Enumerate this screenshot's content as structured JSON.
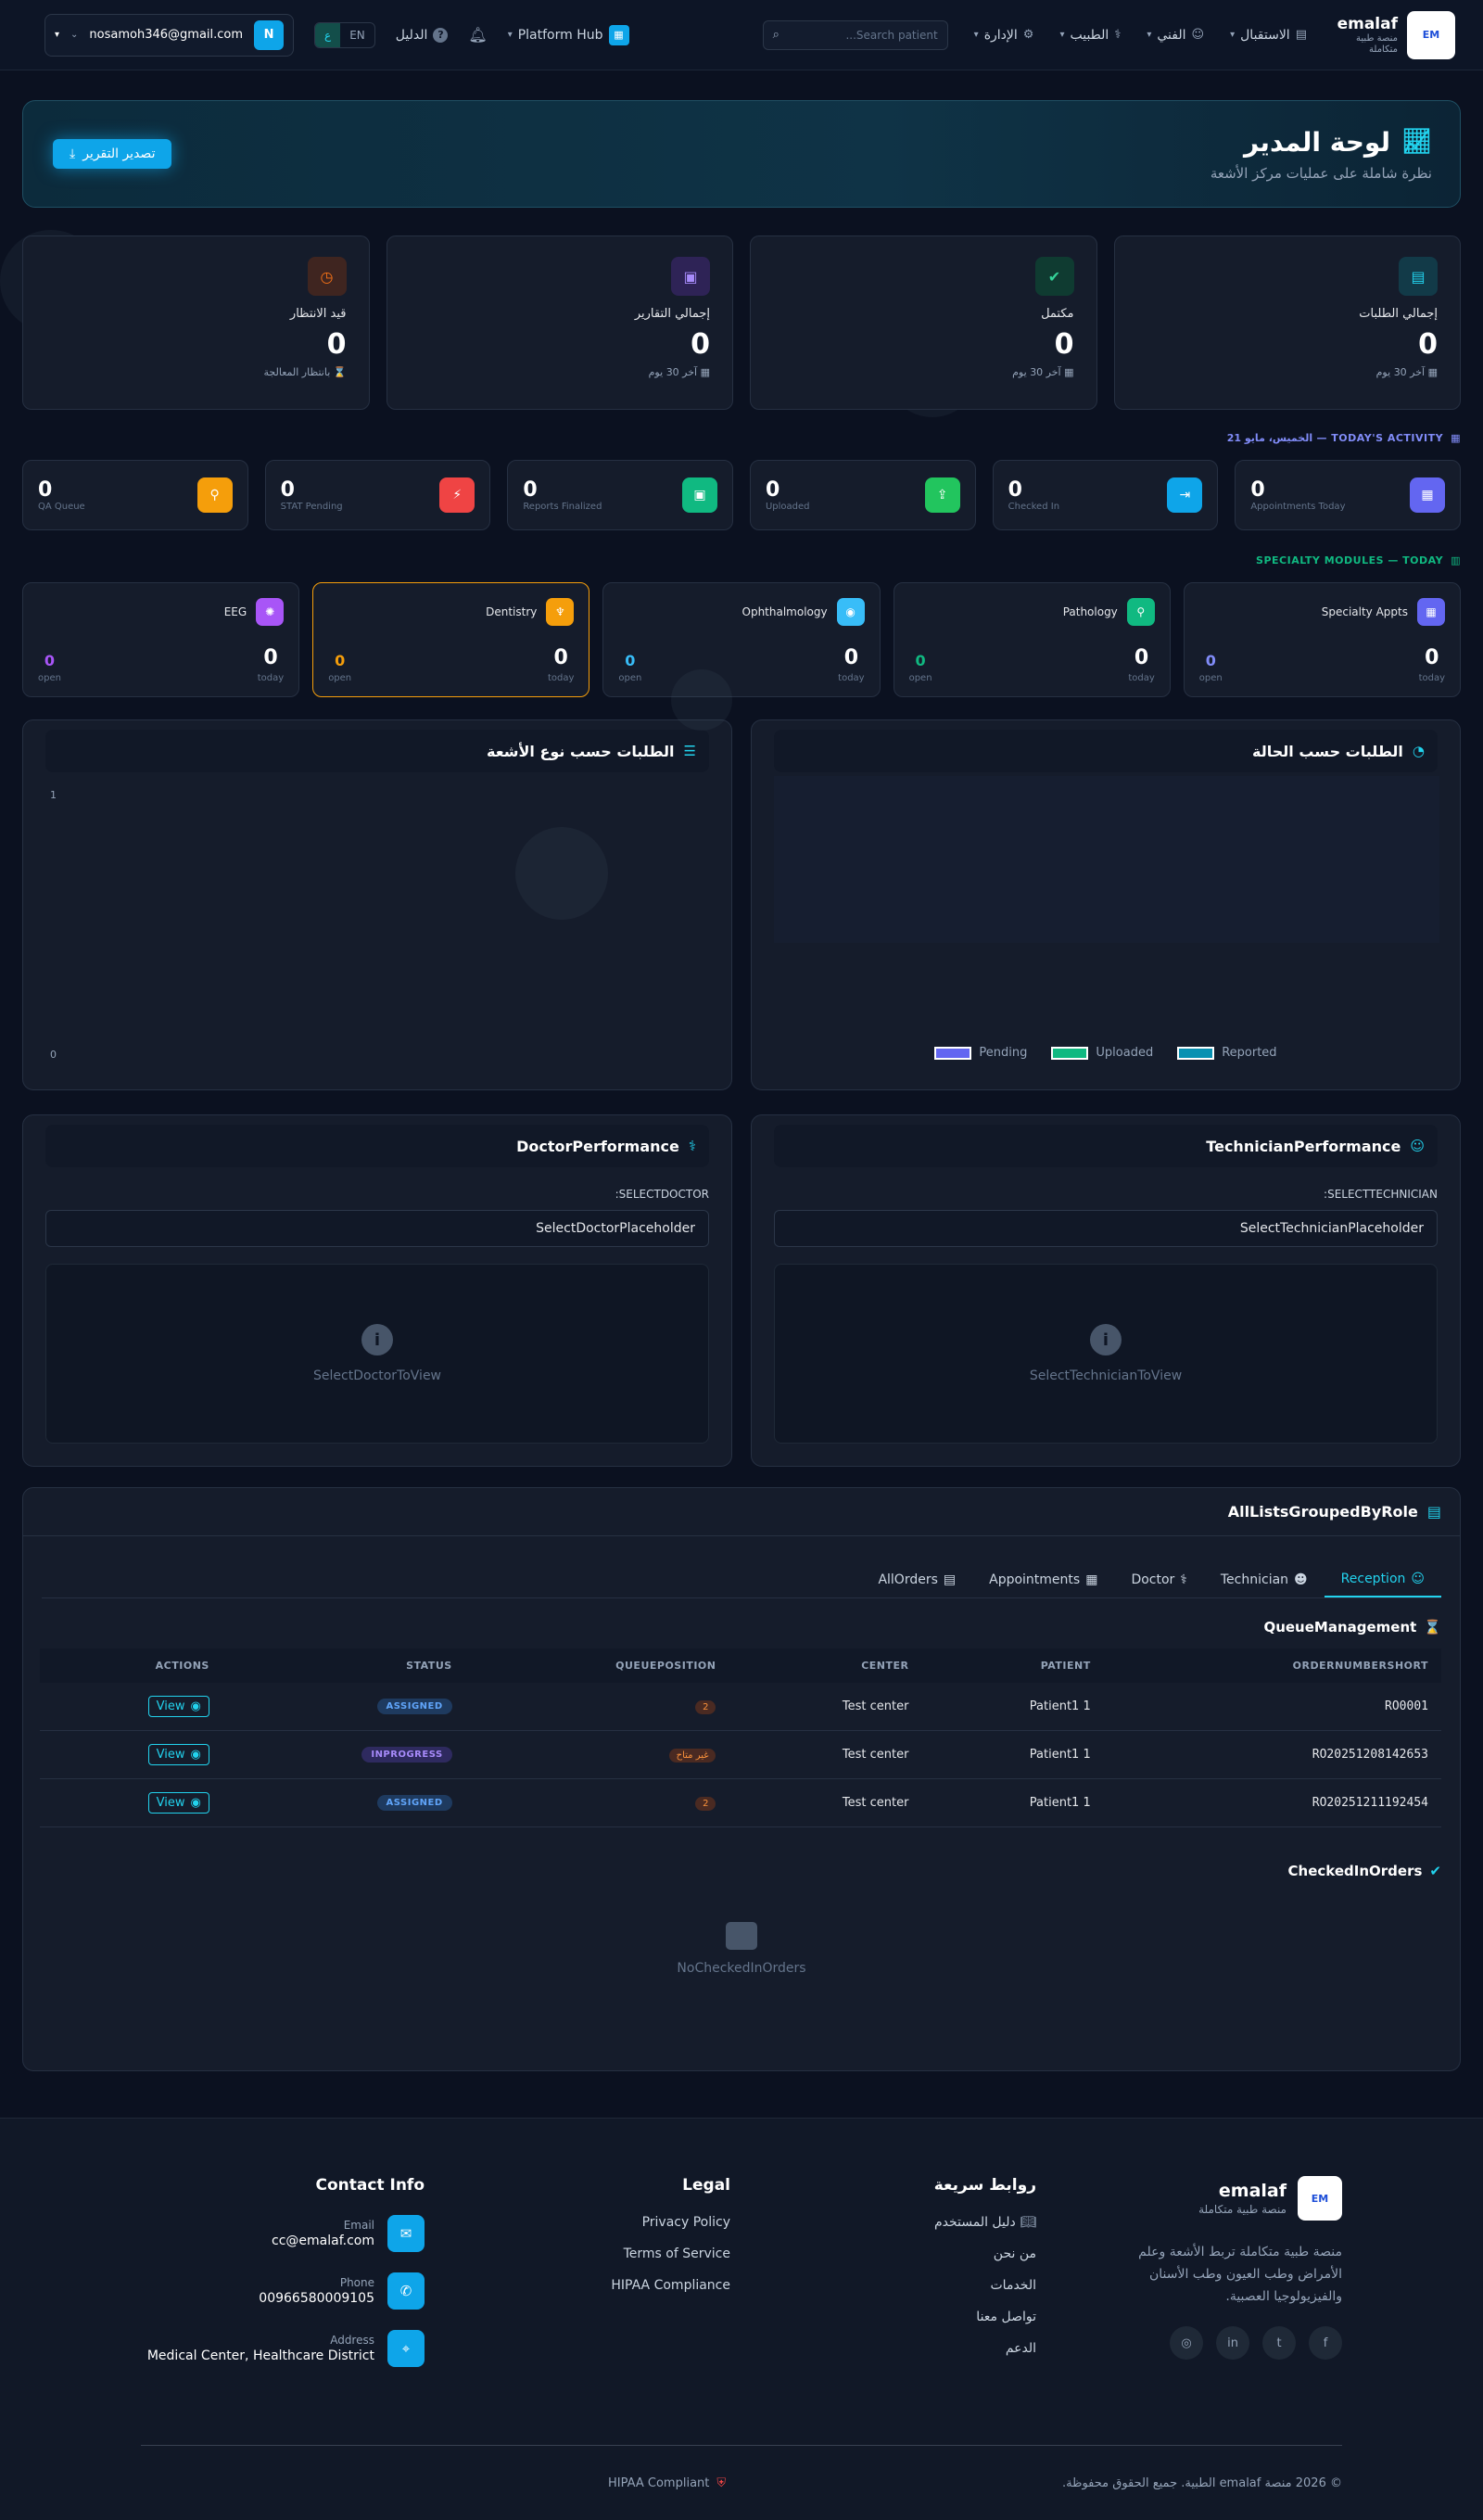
{
  "nav": {
    "brand_name": "emalaf",
    "brand_sub": "منصة طبية متكاملة",
    "items": [
      {
        "label": "الاستقبال"
      },
      {
        "label": "الفني"
      },
      {
        "label": "الطبيب"
      },
      {
        "label": "الإدارة"
      }
    ],
    "search_placeholder": "Search patient...",
    "platform_hub": "Platform Hub",
    "guide": "الدليل",
    "lang_en": "EN",
    "lang_ar": "ع",
    "user_email": "nosamoh346@gmail.com",
    "user_initial": "N"
  },
  "hero": {
    "title": "لوحة المدير",
    "subtitle": "نظرة شاملة على عمليات مركز الأشعة",
    "export_label": "تصدير التقرير"
  },
  "kpis": [
    {
      "label": "إجمالي الطلبات",
      "value": "0",
      "foot": "آخر 30 يوم",
      "color": "#0e7490",
      "icon": "clipboard-icon"
    },
    {
      "label": "مكتمل",
      "value": "0",
      "foot": "آخر 30 يوم",
      "color": "#047857",
      "icon": "check-icon"
    },
    {
      "label": "إجمالي التقارير",
      "value": "0",
      "foot": "آخر 30 يوم",
      "color": "#5b21b6",
      "icon": "report-icon"
    },
    {
      "label": "قيد الانتظار",
      "value": "0",
      "foot": "بانتظار المعالجة",
      "color": "#9a3412",
      "icon": "clock-icon"
    }
  ],
  "activity": {
    "header": "TODAY'S ACTIVITY — الخميس، مايو 21",
    "items": [
      {
        "label": "Appointments Today",
        "value": "0",
        "color": "#6366f1"
      },
      {
        "label": "Checked In",
        "value": "0",
        "color": "#0ea5e9"
      },
      {
        "label": "Uploaded",
        "value": "0",
        "color": "#22c55e"
      },
      {
        "label": "Reports Finalized",
        "value": "0",
        "color": "#10b981"
      },
      {
        "label": "STAT Pending",
        "value": "0",
        "color": "#ef4444"
      },
      {
        "label": "QA Queue",
        "value": "0",
        "color": "#f59e0b"
      }
    ]
  },
  "specialty": {
    "header": "SPECIALTY MODULES — TODAY",
    "items": [
      {
        "name": "Specialty Appts",
        "today": "0",
        "open": "0",
        "color": "#6366f1",
        "open_color": "#818cf8"
      },
      {
        "name": "Pathology",
        "today": "0",
        "open": "0",
        "color": "#10b981",
        "open_color": "#10b981"
      },
      {
        "name": "Ophthalmology",
        "today": "0",
        "open": "0",
        "color": "#38bdf8",
        "open_color": "#38bdf8"
      },
      {
        "name": "Dentistry",
        "today": "0",
        "open": "0",
        "color": "#f59e0b",
        "open_color": "#f59e0b"
      },
      {
        "name": "EEG",
        "today": "0",
        "open": "0",
        "color": "#a855f7",
        "open_color": "#a855f7"
      }
    ],
    "today_label": "today",
    "open_label": "open"
  },
  "charts": {
    "status_title": "الطلبات حسب الحالة",
    "modality_title": "الطلبات حسب نوع الأشعة",
    "legend": [
      {
        "name": "Pending",
        "color": "#6366f1"
      },
      {
        "name": "Uploaded",
        "color": "#10b981"
      },
      {
        "name": "Reported",
        "color": "#0891b2"
      }
    ]
  },
  "chart_data": [
    {
      "type": "pie",
      "categories": [
        "Pending",
        "Uploaded",
        "Reported"
      ],
      "values": [
        0,
        0,
        0
      ],
      "title": "الطلبات حسب الحالة"
    },
    {
      "type": "bar",
      "categories": [],
      "values": [],
      "title": "الطلبات حسب نوع الأشعة",
      "ylim": [
        0,
        1
      ],
      "yticks": [
        "1",
        "0"
      ]
    }
  ],
  "perf": {
    "tech_title": "TechnicianPerformance",
    "tech_label": "SELECTTECHNICIAN:",
    "tech_select": "SelectTechnicianPlaceholder",
    "tech_empty": "SelectTechnicianToView",
    "doc_title": "DoctorPerformance",
    "doc_label": "SELECTDOCTOR:",
    "doc_select": "SelectDoctorPlaceholder",
    "doc_empty": "SelectDoctorToView"
  },
  "lists": {
    "title": "AllListsGroupedByRole",
    "tabs": [
      "Reception",
      "Technician",
      "Doctor",
      "Appointments",
      "AllOrders"
    ],
    "queue_title": "QueueManagement",
    "columns": [
      "ORDERNUMBERSHORT",
      "PATIENT",
      "CENTER",
      "QUEUEPOSITION",
      "STATUS",
      "ACTIONS"
    ],
    "rows": [
      {
        "order": "RO0001",
        "patient": "Patient1 1",
        "center": "Test center",
        "queue": "2",
        "status": "ASSIGNED",
        "action": "View"
      },
      {
        "order": "RO20251208142653",
        "patient": "Patient1 1",
        "center": "Test center",
        "queue": "غير متاح",
        "status": "INPROGRESS",
        "action": "View"
      },
      {
        "order": "RO20251211192454",
        "patient": "Patient1 1",
        "center": "Test center",
        "queue": "2",
        "status": "ASSIGNED",
        "action": "View"
      }
    ],
    "checked_title": "CheckedInOrders",
    "checked_empty": "NoCheckedInOrders"
  },
  "footer": {
    "brand_name": "emalaf",
    "brand_sub": "منصة طبية متكاملة",
    "description": "منصة طبية متكاملة تربط الأشعة وعلم الأمراض وطب العيون وطب الأسنان والفيزيولوجيا العصبية.",
    "quick_title": "روابط سريعة",
    "quick_links": [
      "دليل المستخدم",
      "من نحن",
      "الخدمات",
      "تواصل معنا",
      "الدعم"
    ],
    "legal_title": "Legal",
    "legal_links": [
      "Privacy Policy",
      "Terms of Service",
      "HIPAA Compliance"
    ],
    "contact_title": "Contact Info",
    "email_label": "Email",
    "email": "cc@emalaf.com",
    "phone_label": "Phone",
    "phone": "00966580009105",
    "address_label": "Address",
    "address": "Medical Center, Healthcare District",
    "copyright": "© 2026 منصة emalaf الطبية. جميع الحقوق محفوظة.",
    "hipaa": "HIPAA Compliant"
  }
}
